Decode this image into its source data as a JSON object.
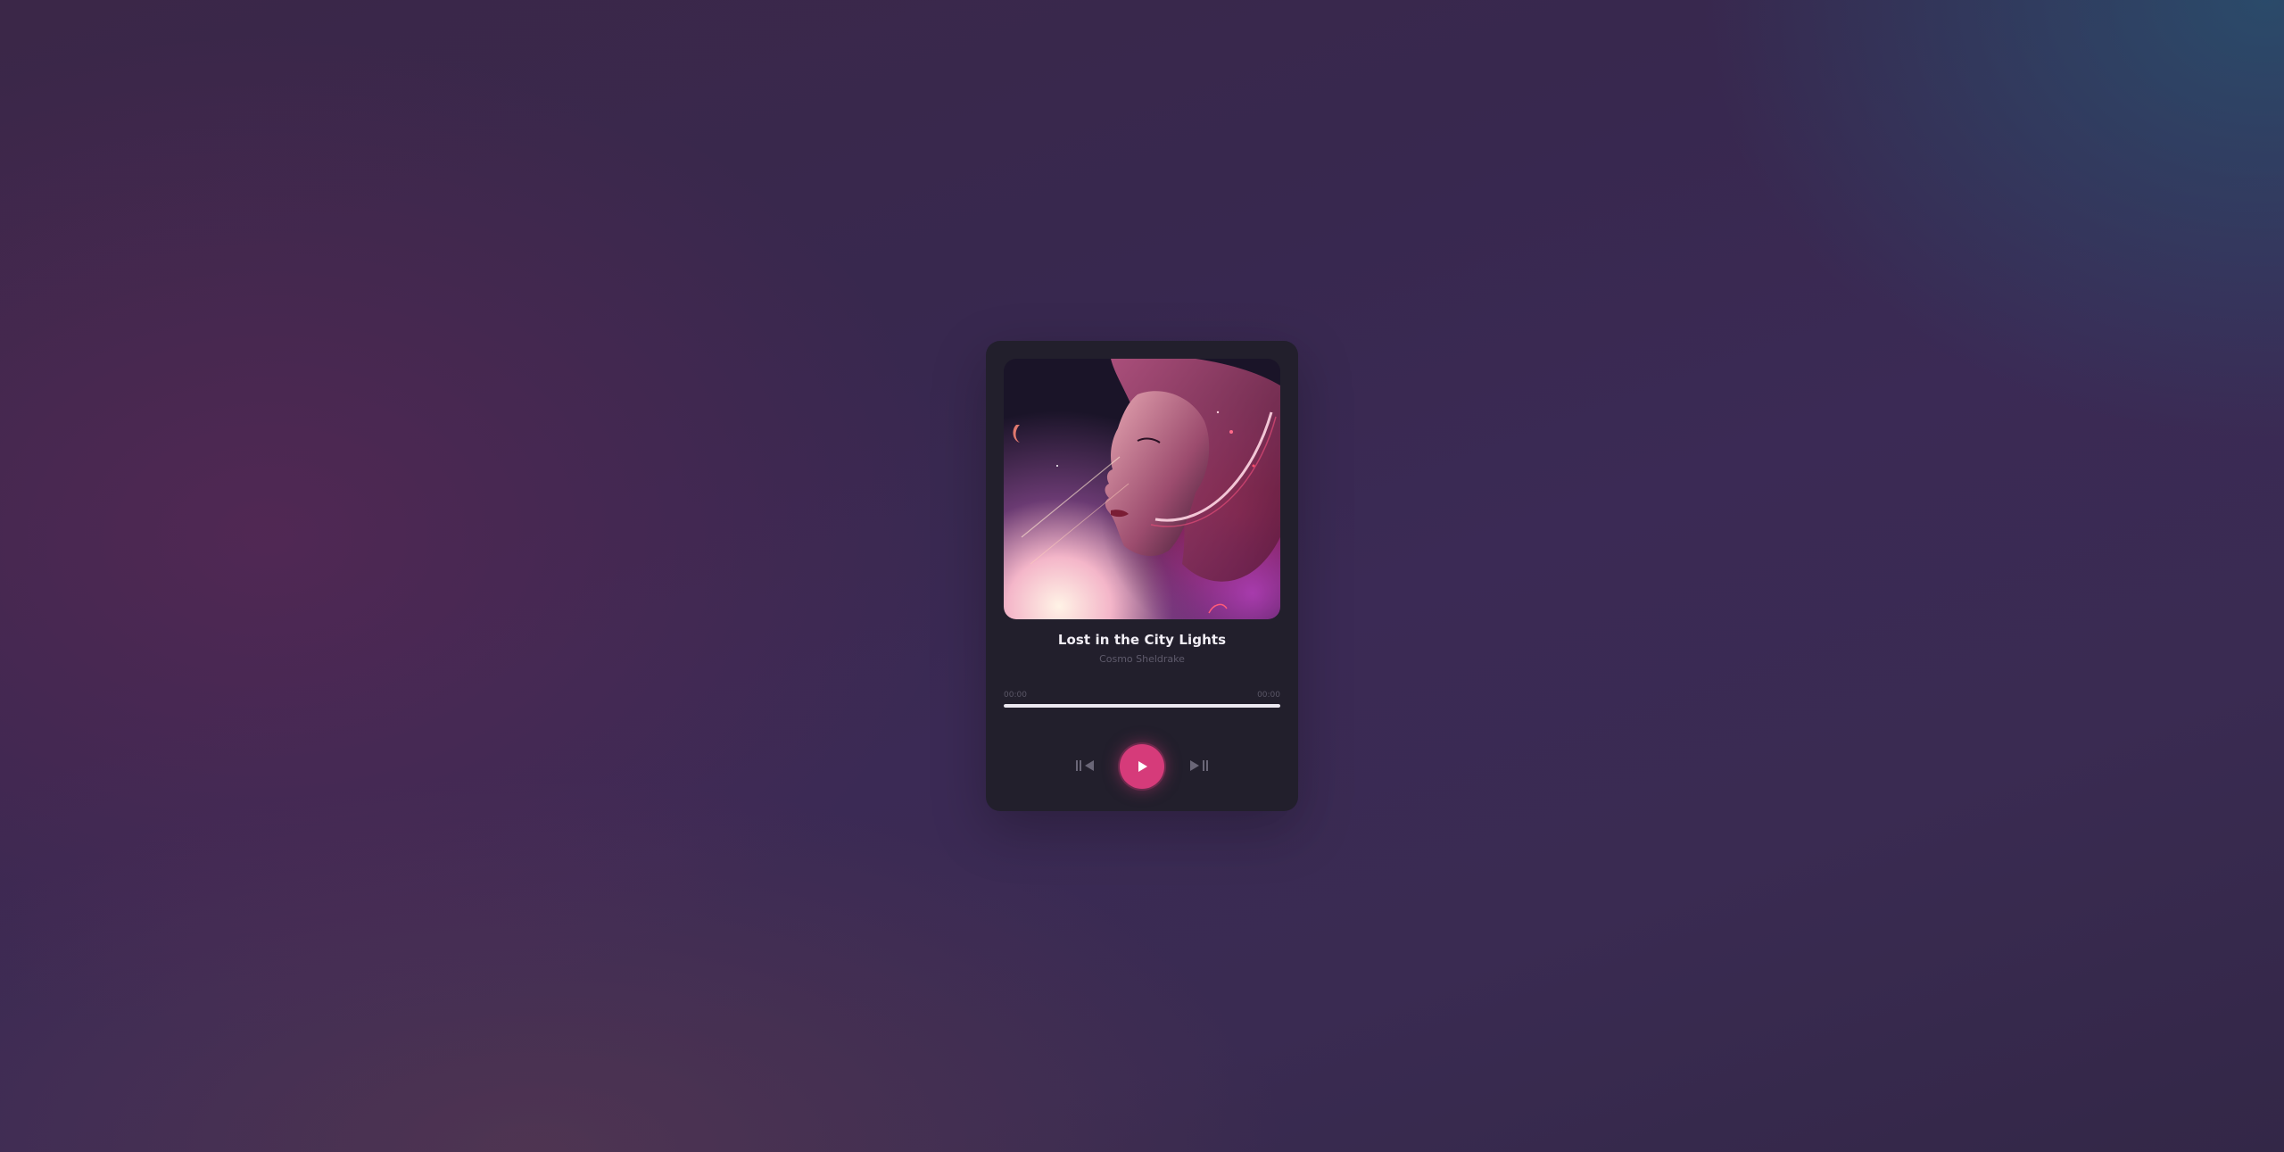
{
  "player": {
    "title": "Lost in the City Lights",
    "artist": "Cosmo Sheldrake",
    "current_time": "00:00",
    "total_time": "00:00",
    "progress": 1.0,
    "accent_color": "#d63b7a",
    "cover_image": "album-cover-woman-nebula"
  },
  "controls": {
    "prev_icon": "skip-previous-icon",
    "play_icon": "play-icon",
    "next_icon": "skip-next-icon"
  }
}
